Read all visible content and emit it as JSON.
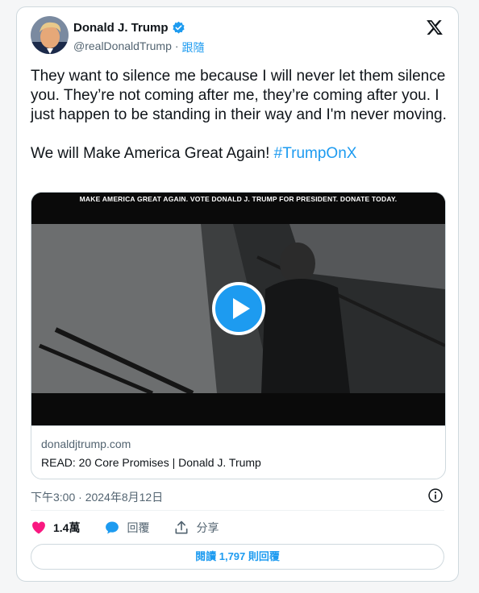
{
  "author": {
    "name": "Donald J. Trump",
    "handle": "@realDonaldTrump",
    "separator": "·",
    "follow_label": "跟隨"
  },
  "tweet": {
    "text": "They want to silence me because I will never let them silence you. They’re not coming after me, they’re coming after you. I just happen to be standing in their way and I'm never moving.\n\nWe will Make America Great Again! ",
    "hashtag": "#TrumpOnX"
  },
  "media": {
    "banner": "MAKE AMERICA GREAT AGAIN. VOTE DONALD J. TRUMP FOR PRESIDENT. DONATE TODAY.",
    "domain": "donaldjtrump.com",
    "title": "READ: 20 Core Promises | Donald J. Trump"
  },
  "timestamp": "下午3:00 · 2024年8月12日",
  "actions": {
    "likes": "1.4萬",
    "reply_label": "回覆",
    "share_label": "分享"
  },
  "read_replies": "閱讀 1,797 則回覆",
  "colors": {
    "accent": "#1d9bf0",
    "like": "#f91880",
    "muted": "#536471"
  }
}
